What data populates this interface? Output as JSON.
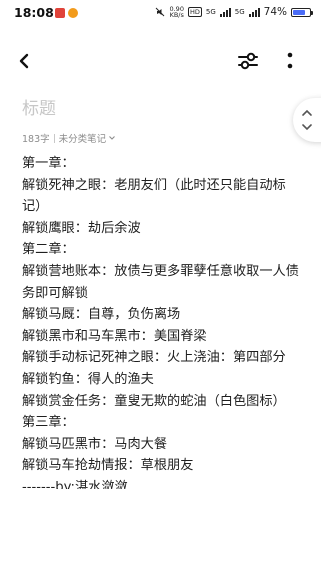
{
  "status_bar": {
    "time": "18:08",
    "net_speed_value": "0.90",
    "net_speed_unit": "KB/s",
    "hd_label": "HD",
    "signal_label_1": "5G",
    "signal_label_2": "5G",
    "battery": "74%",
    "battery_level": 0.74,
    "battery_color": "#4a6cf7"
  },
  "toolbar": {
    "back_icon": "chevron-left-icon",
    "format_icon": "sliders-icon",
    "more_icon": "more-vertical-icon"
  },
  "note": {
    "title_placeholder": "标题",
    "word_count": "183字",
    "category": "未分类笔记",
    "lines": [
      "第一章：",
      "解锁死神之眼：老朋友们（此时还只能自动标记）",
      "解锁鹰眼：劫后余波",
      "第二章：",
      "解锁营地账本：放债与更多罪孽任意收取一人债务即可解锁",
      "解锁马厩：自尊，负伤离场",
      "解锁黑市和马车黑市：美国脊梁",
      "解锁手动标记死神之眼：火上浇油：第四部分",
      "解锁钓鱼：得人的渔夫",
      "解锁赏金任务：童叟无欺的蛇油（白色图标）",
      "第三章：",
      "解锁马匹黑市：马肉大餐",
      "解锁马车抢劫情报：草根朋友",
      "-------by:湛水潋潋"
    ]
  }
}
